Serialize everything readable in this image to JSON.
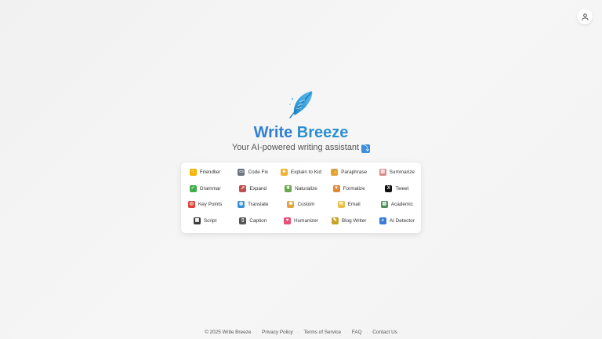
{
  "header": {
    "user_button_icon": "user-icon"
  },
  "brand": {
    "logo_icon": "feather-icon",
    "name_part1": "Write",
    "name_part2": "Breeze",
    "tagline": "Your AI-powered writing assistant",
    "tagline_icon": "arrow-down-icon",
    "tagline_icon_glyph": "⤵"
  },
  "modes": [
    {
      "label": "Friendlier",
      "icon": "hugging-face-icon",
      "glyph": "☺",
      "color": "#f4b400"
    },
    {
      "label": "Code Fix",
      "icon": "laptop-icon",
      "glyph": "▭",
      "color": "#6b7280"
    },
    {
      "label": "Explain to Kid",
      "icon": "baby-icon",
      "glyph": "☻",
      "color": "#f2b233"
    },
    {
      "label": "Paraphrase",
      "icon": "writing-hand-icon",
      "glyph": "✍",
      "color": "#e9a23b"
    },
    {
      "label": "Summarize",
      "icon": "chart-icon",
      "glyph": "▥",
      "color": "#d98a8a"
    },
    {
      "label": "Grammar",
      "icon": "check-mark-icon",
      "glyph": "✓",
      "color": "#3fae49"
    },
    {
      "label": "Expand",
      "icon": "rocket-icon",
      "glyph": "➚",
      "color": "#c0504d"
    },
    {
      "label": "Naturalize",
      "icon": "herb-icon",
      "glyph": "❦",
      "color": "#6aa84f"
    },
    {
      "label": "Formalize",
      "icon": "necktie-icon",
      "glyph": "▼",
      "color": "#e08b3a"
    },
    {
      "label": "Tweet",
      "icon": "x-icon",
      "glyph": "X",
      "color": "#111111"
    },
    {
      "label": "Key Points",
      "icon": "target-icon",
      "glyph": "◎",
      "color": "#e0413a"
    },
    {
      "label": "Translate",
      "icon": "globe-icon",
      "glyph": "◍",
      "color": "#3a8fd9"
    },
    {
      "label": "Custom",
      "icon": "palette-icon",
      "glyph": "✺",
      "color": "#e6a23c"
    },
    {
      "label": "Email",
      "icon": "envelope-icon",
      "glyph": "✉",
      "color": "#e8c04a"
    },
    {
      "label": "Academic",
      "icon": "books-icon",
      "glyph": "▤",
      "color": "#4a8f5a"
    },
    {
      "label": "Script",
      "icon": "clapper-board-icon",
      "glyph": "▦",
      "color": "#3c3c3c"
    },
    {
      "label": "Caption",
      "icon": "mobile-phone-icon",
      "glyph": "▯",
      "color": "#555555"
    },
    {
      "label": "Humanizer",
      "icon": "heart-icon",
      "glyph": "♥",
      "color": "#e94e77"
    },
    {
      "label": "Blog Writer",
      "icon": "memo-icon",
      "glyph": "✎",
      "color": "#c9a227"
    },
    {
      "label": "AI Detector",
      "icon": "magnifier-icon",
      "glyph": "⌕",
      "color": "#3a7bd5"
    }
  ],
  "footer": {
    "copyright": "© 2025 Write Breeze",
    "separator": "·",
    "links": [
      "Privacy Policy",
      "Terms of Service",
      "FAQ",
      "Contact Us"
    ]
  },
  "colors": {
    "brand_blue": "#2f7fd6",
    "background": "#f3f3f3",
    "card": "#ffffff"
  }
}
